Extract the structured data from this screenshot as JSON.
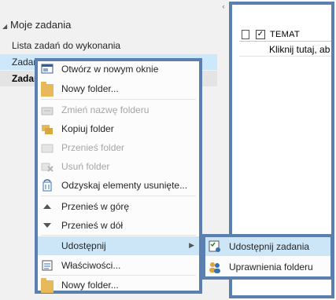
{
  "nav": {
    "collapse_glyph": "‹",
    "group_arrow": "◢",
    "group_title": "Moje zadania",
    "items": [
      {
        "label": "Lista zadań do wykonania"
      },
      {
        "label": "Zadan"
      },
      {
        "label": "Zadan"
      }
    ]
  },
  "tasklist": {
    "header_check": "✓",
    "header_subject": "TEMAT",
    "new_task_prompt": "Kliknij tutaj, ab"
  },
  "context_menu": {
    "items": [
      {
        "label": "Otwórz w nowym oknie",
        "icon": "open-window-icon",
        "enabled": true
      },
      {
        "label": "Nowy folder...",
        "icon": "folder-icon",
        "enabled": true
      },
      {
        "label": "Zmień nazwę folderu",
        "icon": "rename-folder-icon",
        "enabled": false
      },
      {
        "label": "Kopiuj folder",
        "icon": "copy-folder-icon",
        "enabled": true
      },
      {
        "label": "Przenieś folder",
        "icon": "move-folder-icon",
        "enabled": false
      },
      {
        "label": "Usuń folder",
        "icon": "delete-folder-icon",
        "enabled": false
      },
      {
        "label": "Odzyskaj elementy usunięte...",
        "icon": "recover-deleted-icon",
        "enabled": true
      },
      {
        "label": "Przenieś w górę",
        "icon": "move-up-icon",
        "enabled": true
      },
      {
        "label": "Przenieś w dół",
        "icon": "move-down-icon",
        "enabled": true
      },
      {
        "label": "Udostępnij",
        "icon": "share-icon",
        "enabled": true,
        "submenu_arrow": "▶"
      },
      {
        "label": "Właściwości...",
        "icon": "properties-icon",
        "enabled": true
      },
      {
        "label": "Nowy folder...",
        "icon": "folder-icon",
        "enabled": true
      }
    ]
  },
  "submenu": {
    "items": [
      {
        "label": "Udostępnij zadania",
        "icon": "share-tasks-icon"
      },
      {
        "label": "Uprawnienia folderu",
        "icon": "folder-permissions-icon"
      }
    ]
  },
  "colors": {
    "highlight_frame": "#5b7fae",
    "menu_hover": "#cde6f7",
    "nav_selected": "#cde8fb",
    "folder": "#e8b95a"
  }
}
